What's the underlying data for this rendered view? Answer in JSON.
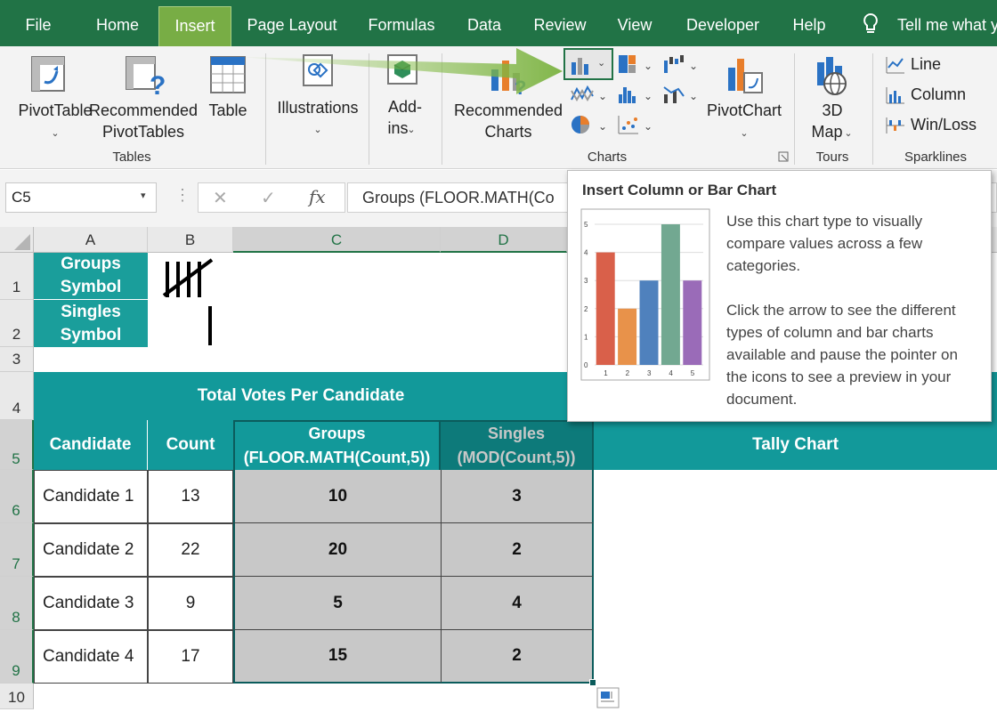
{
  "tabs": [
    "File",
    "Home",
    "Insert",
    "Page Layout",
    "Formulas",
    "Data",
    "Review",
    "View",
    "Developer",
    "Help"
  ],
  "active_tab": "Insert",
  "tell_me": "Tell me what y",
  "ribbon": {
    "pivottable": "PivotTable",
    "recommended_pivot_1": "Recommended",
    "recommended_pivot_2": "PivotTables",
    "table": "Table",
    "illustrations": "Illustrations",
    "addins_1": "Add-",
    "addins_2": "ins",
    "recommended_charts_1": "Recommended",
    "recommended_charts_2": "Charts",
    "pivotchart": "PivotChart",
    "map3d_1": "3D",
    "map3d_2": "Map",
    "line": "Line",
    "column": "Column",
    "winloss": "Win/Loss",
    "group_tables": "Tables",
    "group_charts": "Charts",
    "group_tours": "Tours",
    "group_sparklines": "Sparklines"
  },
  "formula_bar": {
    "name_box": "C5",
    "formula": "Groups (FLOOR.MATH(Co"
  },
  "columns": [
    "A",
    "B",
    "C",
    "D"
  ],
  "rows": [
    "1",
    "2",
    "3",
    "4",
    "5",
    "6",
    "7",
    "8",
    "9",
    "10"
  ],
  "sheet": {
    "a1": [
      "Groups",
      "Symbol"
    ],
    "a2": [
      "Singles",
      "Symbol"
    ],
    "title": "Total Votes Per Candidate",
    "headers": {
      "candidate": "Candidate",
      "count": "Count",
      "groups_1": "Groups",
      "groups_2": "(FLOOR.MATH(Count,5))",
      "singles_1": "Singles",
      "singles_2": "(MOD(Count,5))",
      "tally": "Tally Chart"
    },
    "data": [
      {
        "candidate": "Candidate 1",
        "count": "13",
        "groups": "10",
        "singles": "3"
      },
      {
        "candidate": "Candidate 2",
        "count": "22",
        "groups": "20",
        "singles": "2"
      },
      {
        "candidate": "Candidate 3",
        "count": "9",
        "groups": "5",
        "singles": "4"
      },
      {
        "candidate": "Candidate 4",
        "count": "17",
        "groups": "15",
        "singles": "2"
      }
    ]
  },
  "tooltip": {
    "title": "Insert Column or Bar Chart",
    "p1": [
      "Use this chart type to visually",
      "compare values across a few",
      "categories."
    ],
    "p2": [
      "Click the arrow to see the different",
      "types of column and bar charts",
      "available and pause the pointer on",
      "the icons to see a preview in your",
      "document."
    ],
    "preview_chart": {
      "type": "bar",
      "categories": [
        "1",
        "2",
        "3",
        "4",
        "5"
      ],
      "values": [
        4,
        2,
        3,
        5,
        3
      ],
      "yticks": [
        "0",
        "1",
        "2",
        "3",
        "4",
        "5"
      ],
      "colors": [
        "#d9604a",
        "#e8924a",
        "#4f81bd",
        "#72a891",
        "#9a6bb8"
      ]
    }
  },
  "colors": {
    "excel_green": "#217346",
    "teal": "#1a9e9b",
    "selection": "#c8c8c8"
  }
}
